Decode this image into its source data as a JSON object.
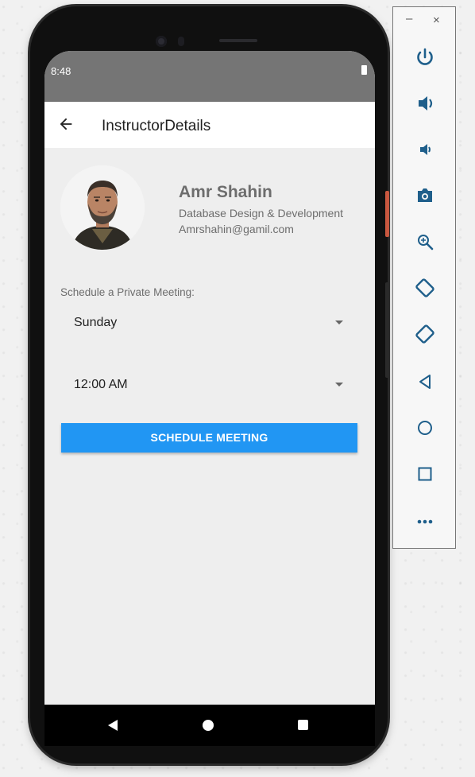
{
  "status": {
    "time": "8:48"
  },
  "appbar": {
    "title": "InstructorDetails"
  },
  "instructor": {
    "name": "Amr Shahin",
    "course": "Database Design & Development",
    "email": "Amrshahin@gamil.com"
  },
  "schedule": {
    "label": "Schedule a Private Meeting:",
    "day": "Sunday",
    "time": "12:00 AM",
    "button_label": "SCHEDULE MEETING"
  },
  "colors": {
    "primary": "#2196f3",
    "statusbar": "#757575",
    "background": "#eeeeee"
  },
  "emulator_toolbar": {
    "minimize": "–",
    "close": "×",
    "icons": [
      "power-icon",
      "volume-up-icon",
      "volume-down-icon",
      "camera-icon",
      "zoom-icon",
      "rotate-left-icon",
      "rotate-right-icon",
      "back-icon",
      "home-icon",
      "overview-icon",
      "more-icon"
    ]
  }
}
